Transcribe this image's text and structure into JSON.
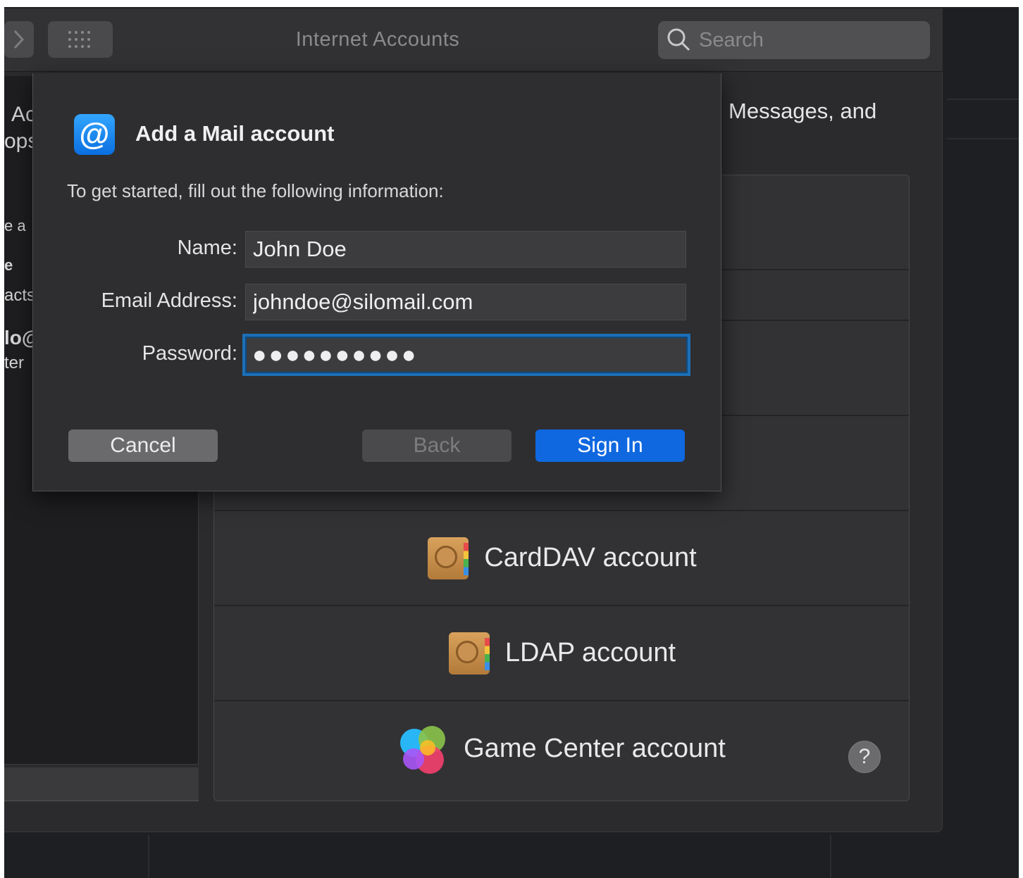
{
  "window": {
    "title": "Internet Accounts",
    "search_placeholder": "Search"
  },
  "sidebar": {
    "fragments": [
      "Ac",
      "ops",
      "e a",
      "e",
      "acts",
      "lo@",
      "ter"
    ]
  },
  "header": {
    "text_fragment": "Messages, and"
  },
  "providers": [
    {
      "label": "CardDAV account",
      "icon": "address-book-icon"
    },
    {
      "label": "LDAP account",
      "icon": "address-book-icon"
    },
    {
      "label": "Game Center account",
      "icon": "game-center-icon"
    }
  ],
  "help": {
    "label": "?"
  },
  "sheet": {
    "title": "Add a Mail account",
    "subtitle": "To get started, fill out the following information:",
    "icon_glyph": "@",
    "fields": {
      "name": {
        "label": "Name:",
        "value": "John Doe"
      },
      "email": {
        "label": "Email Address:",
        "value": "johndoe@silomail.com"
      },
      "password": {
        "label": "Password:",
        "value": "●●●●●●●●●●"
      }
    },
    "buttons": {
      "cancel": "Cancel",
      "back": "Back",
      "sign_in": "Sign In"
    }
  },
  "colors": {
    "accent": "#0f68e0",
    "focus_ring": "#1d6fb5",
    "window_bg": "#2b2b2d"
  }
}
